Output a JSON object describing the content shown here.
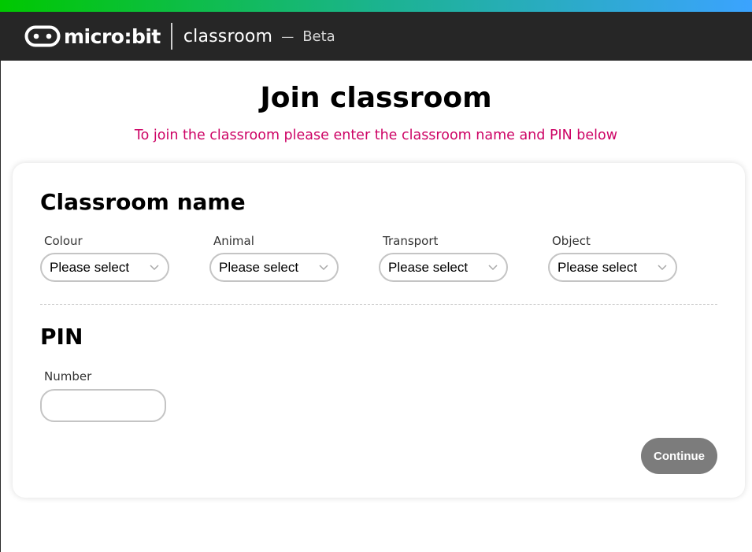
{
  "header": {
    "logo_text": "micro:bit",
    "app_name": "classroom",
    "separator": "—",
    "badge": "Beta",
    "accent_gradient": [
      "#00c800",
      "#3ba3ff"
    ],
    "background": "#262626"
  },
  "main": {
    "title": "Join classroom",
    "subtitle": "To join the classroom please enter the classroom name and PIN below",
    "subtitle_color": "#cd0365"
  },
  "classroom_name": {
    "title": "Classroom name",
    "fields": [
      {
        "label": "Colour",
        "value": "Please select"
      },
      {
        "label": "Animal",
        "value": "Please select"
      },
      {
        "label": "Transport",
        "value": "Please select"
      },
      {
        "label": "Object",
        "value": "Please select"
      }
    ],
    "dropdown_icon": "chevron-down-icon"
  },
  "pin": {
    "title": "PIN",
    "number_label": "Number",
    "number_value": ""
  },
  "actions": {
    "continue_label": "Continue",
    "continue_color": "#7c7c7c"
  }
}
